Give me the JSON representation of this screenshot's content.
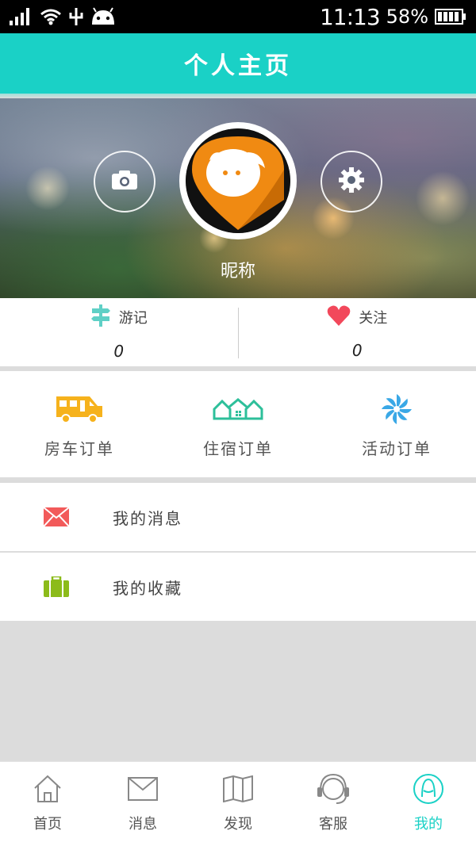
{
  "status_bar": {
    "time": "11:13",
    "battery": "58%"
  },
  "header": {
    "title": "个人主页"
  },
  "profile": {
    "nickname": "昵称"
  },
  "stats": [
    {
      "label": "游记",
      "count": "0",
      "icon": "signpost-icon",
      "color": "#5fd0c6"
    },
    {
      "label": "关注",
      "count": "0",
      "icon": "heart-icon",
      "color": "#f2485b"
    }
  ],
  "orders": [
    {
      "label": "房车订单",
      "icon": "rv-icon",
      "color": "#f6b21c"
    },
    {
      "label": "住宿订单",
      "icon": "houses-icon",
      "color": "#2dbf9a"
    },
    {
      "label": "活动订单",
      "icon": "pinwheel-icon",
      "color": "#3aa8e6"
    }
  ],
  "menu": [
    {
      "label": "我的消息",
      "icon": "envelope-icon",
      "color": "#f25a5a"
    },
    {
      "label": "我的收藏",
      "icon": "briefcase-icon",
      "color": "#8cbb1a"
    }
  ],
  "bottom_nav": [
    {
      "label": "首页",
      "icon": "home-icon",
      "active": false
    },
    {
      "label": "消息",
      "icon": "mail-icon",
      "active": false
    },
    {
      "label": "发现",
      "icon": "map-icon",
      "active": false
    },
    {
      "label": "客服",
      "icon": "headset-icon",
      "active": false
    },
    {
      "label": "我的",
      "icon": "user-icon",
      "active": true
    }
  ],
  "colors": {
    "accent": "#1ad1c6",
    "avatar_orange": "#f08a12"
  }
}
